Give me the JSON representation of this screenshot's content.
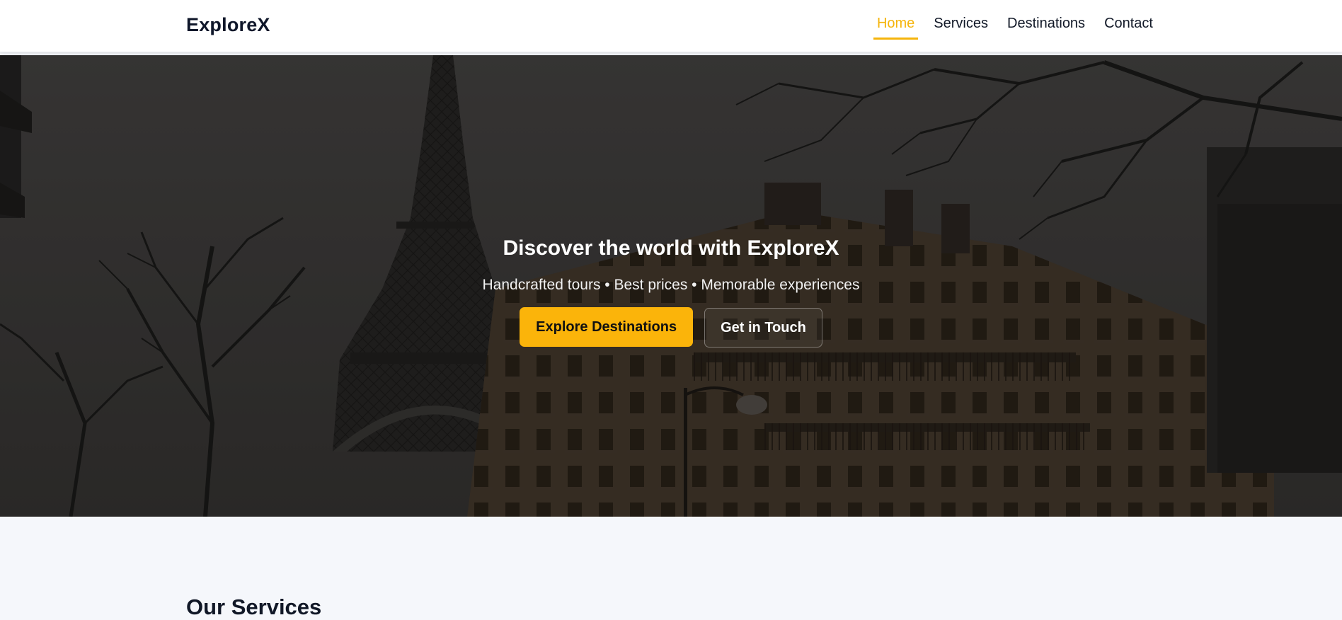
{
  "site": {
    "brand": "ExploreX"
  },
  "nav": {
    "items": [
      {
        "label": "Home",
        "active": true
      },
      {
        "label": "Services",
        "active": false
      },
      {
        "label": "Destinations",
        "active": false
      },
      {
        "label": "Contact",
        "active": false
      }
    ]
  },
  "hero": {
    "title": "Discover the world with ExploreX",
    "subtitle": "Handcrafted tours • Best prices • Memorable experiences",
    "primary_cta": "Explore Destinations",
    "secondary_cta": "Get in Touch",
    "background_icon": "paris-eiffel-tower-street-photo"
  },
  "services": {
    "title": "Our Services"
  },
  "colors": {
    "accent": "#fbb40a",
    "nav_active": "#f5b40b",
    "text_dark": "#111827",
    "page_bg": "#f5f7fb",
    "header_bg": "#ffffff"
  }
}
